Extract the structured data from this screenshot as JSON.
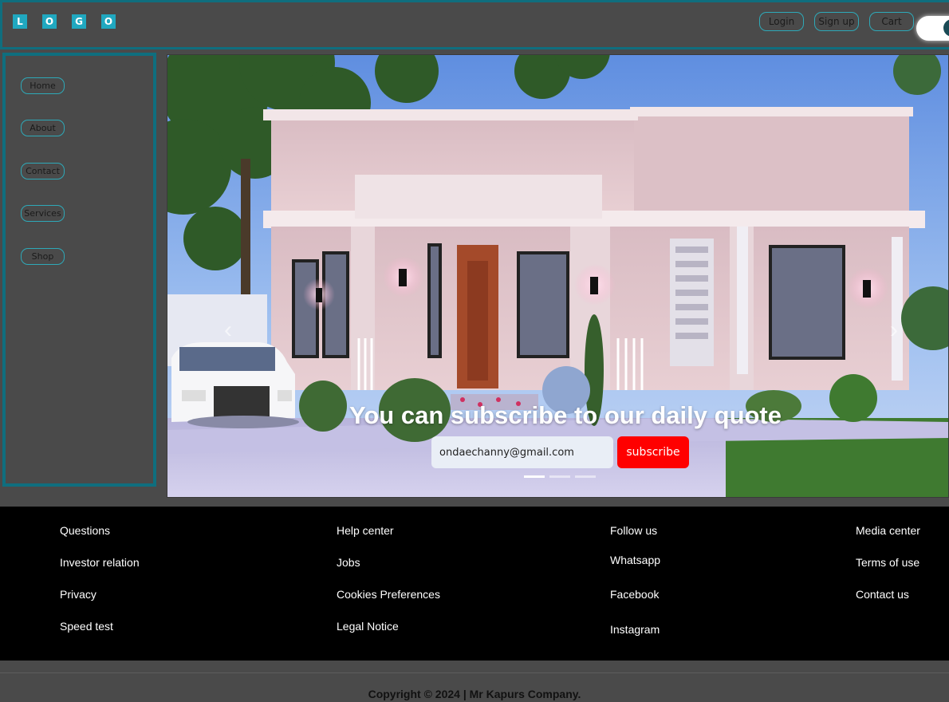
{
  "header": {
    "logo_letters": [
      "L",
      "O",
      "G",
      "O"
    ],
    "buttons": {
      "login": "Login",
      "signup": "Sign up",
      "cart": "Cart"
    }
  },
  "sidebar": {
    "items": [
      {
        "label": "Home"
      },
      {
        "label": "About"
      },
      {
        "label": "Contact"
      },
      {
        "label": "Services"
      },
      {
        "label": "Shop"
      }
    ]
  },
  "hero": {
    "quote": "You can subscribe to our daily quote",
    "email_value": "ondaechanny@gmail.com",
    "subscribe_label": "subscribe",
    "prev_arrow": "‹",
    "next_arrow": "›",
    "slides_total": 3,
    "slide_active": 1
  },
  "footer": {
    "columns": [
      [
        "Questions",
        "Investor relation",
        "Privacy",
        "Speed test"
      ],
      [
        "Help center",
        "Jobs",
        "Cookies Preferences",
        "Legal Notice"
      ],
      [
        "Follow us",
        "Whatsapp",
        "Facebook",
        "Instagram"
      ],
      [
        "Media center",
        "Terms of use",
        "Contact us"
      ]
    ],
    "copyright": "Copyright © 2024 | Mr Kapurs Company."
  },
  "colors": {
    "accent": "#0f6e7e",
    "button_border": "#2ea9b8",
    "subscribe": "#ff0000",
    "footer_bg": "#000000",
    "panel_bg": "#4a4a4a"
  }
}
